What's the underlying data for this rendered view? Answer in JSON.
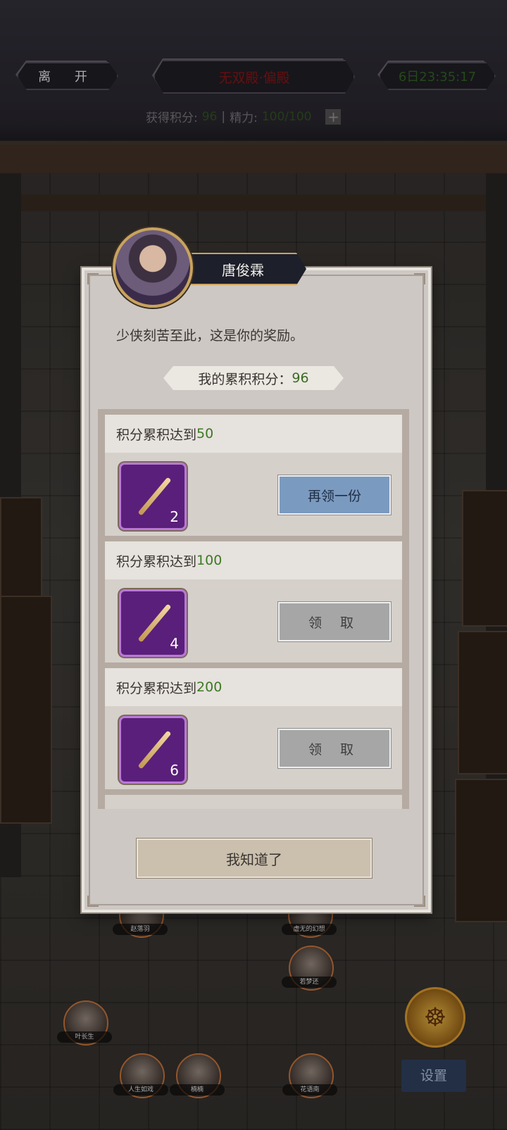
{
  "topbar": {
    "leave_label": "离 开",
    "title": "无双殿·偏殿",
    "timer": "6日23:35:17",
    "score_label": "获得积分:",
    "score_value": "96",
    "separator": "|",
    "energy_label": "精力:",
    "energy_value": "100/100"
  },
  "scene": {
    "characters": [
      "赵落羽",
      "虚无的幻想",
      "若梦还",
      "叶长生",
      "人生如戏",
      "楠楠",
      "花语南"
    ],
    "settings_label": "设置"
  },
  "dialog": {
    "npc_name": "唐俊霖",
    "greeting": "少侠刻苦至此，这是你的奖励。",
    "points_label": "我的累积积分：",
    "points_value": "96",
    "goal_prefix": "积分累积达到",
    "rewards": [
      {
        "goal": "50",
        "count": "2",
        "button": "再领一份",
        "state": "claimable"
      },
      {
        "goal": "100",
        "count": "4",
        "button": "领 取",
        "state": "locked"
      },
      {
        "goal": "200",
        "count": "6",
        "button": "领 取",
        "state": "locked"
      }
    ],
    "confirm_label": "我知道了"
  },
  "colors": {
    "accent_green": "#3c7a23",
    "button_blue": "#7b9ac0",
    "item_purple": "#5a1f7a",
    "title_red": "#7e1313"
  }
}
